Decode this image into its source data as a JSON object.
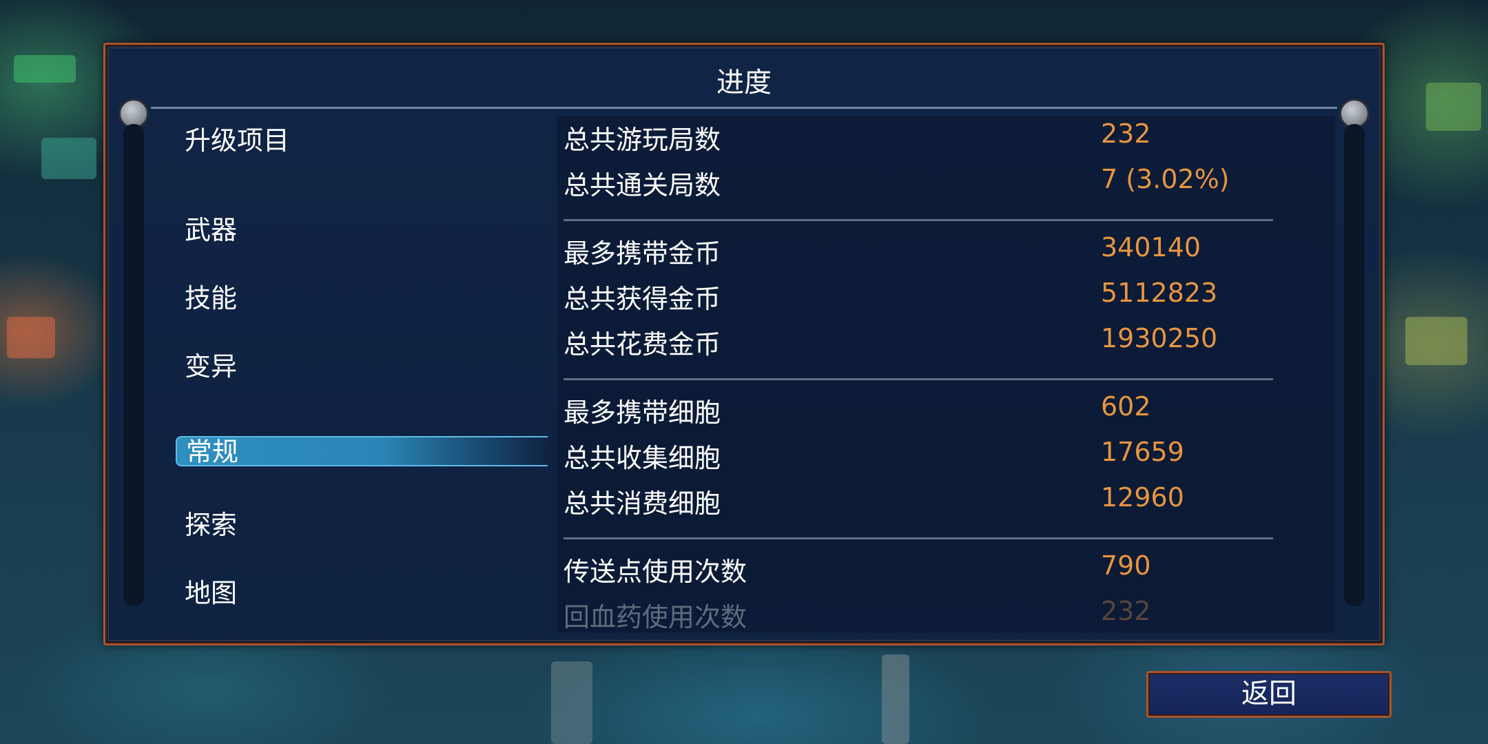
{
  "panel": {
    "title": "进度"
  },
  "categories": [
    {
      "label": "升级项目",
      "selected": false
    },
    {
      "label": "武器",
      "selected": false
    },
    {
      "label": "技能",
      "selected": false
    },
    {
      "label": "变异",
      "selected": false
    },
    {
      "label": "常规",
      "selected": true
    },
    {
      "label": "探索",
      "selected": false
    },
    {
      "label": "地图",
      "selected": false
    }
  ],
  "stats": [
    {
      "label": "总共游玩局数",
      "value": "232"
    },
    {
      "label": "总共通关局数",
      "value": "7 (3.02%)"
    },
    {
      "label": "最多携带金币",
      "value": "340140"
    },
    {
      "label": "总共获得金币",
      "value": "5112823"
    },
    {
      "label": "总共花费金币",
      "value": "1930250"
    },
    {
      "label": "最多携带细胞",
      "value": "602"
    },
    {
      "label": "总共收集细胞",
      "value": "17659"
    },
    {
      "label": "总共消费细胞",
      "value": "12960"
    },
    {
      "label": "传送点使用次数",
      "value": "790"
    },
    {
      "label": "回血药使用次数",
      "value": "232"
    }
  ],
  "footer": {
    "back_label": "返回"
  },
  "colors": {
    "value": "#e8953f",
    "frame": "#a8552f",
    "highlight": "#2f8fbf"
  }
}
